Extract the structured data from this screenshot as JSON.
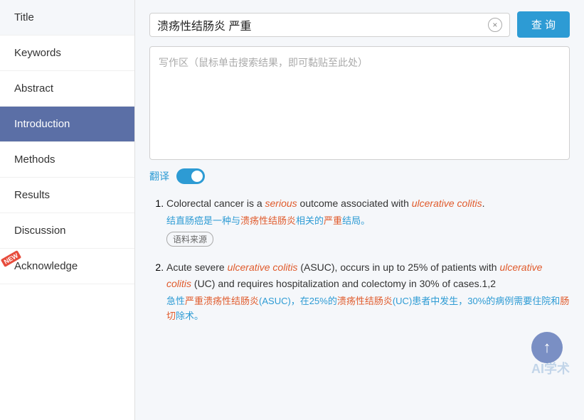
{
  "sidebar": {
    "items": [
      {
        "label": "Title",
        "active": false,
        "new": false
      },
      {
        "label": "Keywords",
        "active": false,
        "new": false
      },
      {
        "label": "Abstract",
        "active": false,
        "new": false
      },
      {
        "label": "Introduction",
        "active": true,
        "new": false
      },
      {
        "label": "Methods",
        "active": false,
        "new": false
      },
      {
        "label": "Results",
        "active": false,
        "new": false
      },
      {
        "label": "Discussion",
        "active": false,
        "new": false
      },
      {
        "label": "Acknowledge",
        "active": false,
        "new": true
      }
    ]
  },
  "search": {
    "value": "溃疡性结肠炎 严重",
    "clear_label": "×",
    "query_label": "查 询",
    "placeholder": "写作区（鼠标单击搜索结果，即可黏贴至此处）"
  },
  "translate": {
    "label": "翻译",
    "enabled": true
  },
  "results": [
    {
      "en": "Colorectal cancer is a <em>serious</em> outcome associated with <em class=\"uc-link\">ulcerative colitis</em>.",
      "cn": "结直肠癌是一种与<em>溃疡性结肠炎</em>相关的<em>严重</em>结局。",
      "source": "语料来源"
    },
    {
      "en": "Acute severe <em>ulcerative colitis</em> (ASUC), occurs in up to 25% of patients with <em>ulcerative colitis</em> (UC) and requires hospitalization and colectomy in 30% of cases.1,2",
      "cn": "急性<em>严重溃疡性结肠炎</em>(ASUC)，在25%的<em>溃疡性结肠炎</em>(UC)患者中发生，30%的病例需要住院和<em>肠切</em>除术。",
      "source": ""
    }
  ],
  "scroll_top": "↑",
  "watermark": "AI学术",
  "new_badge": "NEW"
}
